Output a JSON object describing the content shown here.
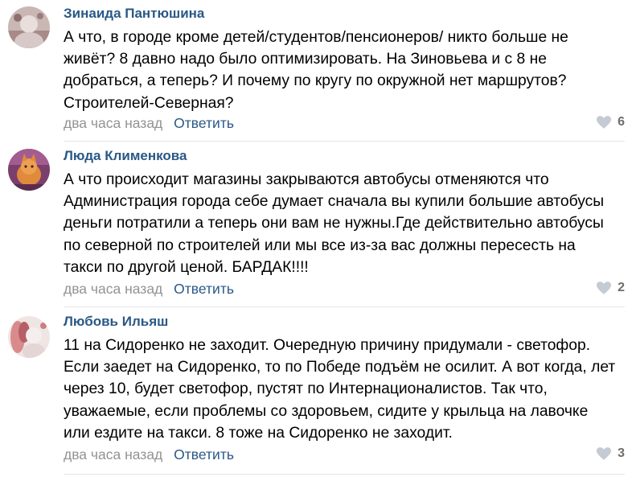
{
  "comments": [
    {
      "author": "Зинаида Пантюшина",
      "text_lines": [
        "А что, в городе кроме детей/студентов/пенсионеров/ никто больше не",
        "живёт? 8 давно надо было оптимизировать. На Зиновьева и с 8 не",
        "добраться, а теперь? И почему по кругу по окружной нет маршрутов?",
        "Строителей-Северная?"
      ],
      "time": "два часа назад",
      "reply_label": "Ответить",
      "likes": "6",
      "avatar_icon": "avatar-photo"
    },
    {
      "author": "Люда Клименкова",
      "text_lines": [
        "А что происходит магазины закрываются автобусы отменяются что",
        "Администрация города себе думает сначала вы купили большие автобусы",
        "деньги потратили а теперь они вам не нужны.Где действительно автобусы",
        "по северной по строителей или мы все из-за вас должны пересесть на",
        "такси по другой ценой. БАРДАК!!!!"
      ],
      "time": "два часа назад",
      "reply_label": "Ответить",
      "likes": "2",
      "avatar_icon": "avatar-photo"
    },
    {
      "author": "Любовь Ильяш",
      "text_lines": [
        "11 на Сидоренко не заходит. Очередную причину придумали - светофор.",
        "Если заедет на Сидоренко, то по Победе подъём не осилит. А вот когда, лет",
        "через 10, будет светофор, пустят по Интернационалистов. Так что,",
        "уважаемые, если проблемы со здоровьем, сидите у крыльца на лавочке",
        "или ездите на такси. 8 тоже на Сидоренко не заходит."
      ],
      "time": "два часа назад",
      "reply_label": "Ответить",
      "likes": "3",
      "avatar_icon": "avatar-photo"
    }
  ],
  "colors": {
    "author_link": "#2a5885",
    "meta_gray": "#939393",
    "like_icon": "#c5cbd2",
    "like_count": "#6e6e6e",
    "divider": "#e2e5ea"
  }
}
